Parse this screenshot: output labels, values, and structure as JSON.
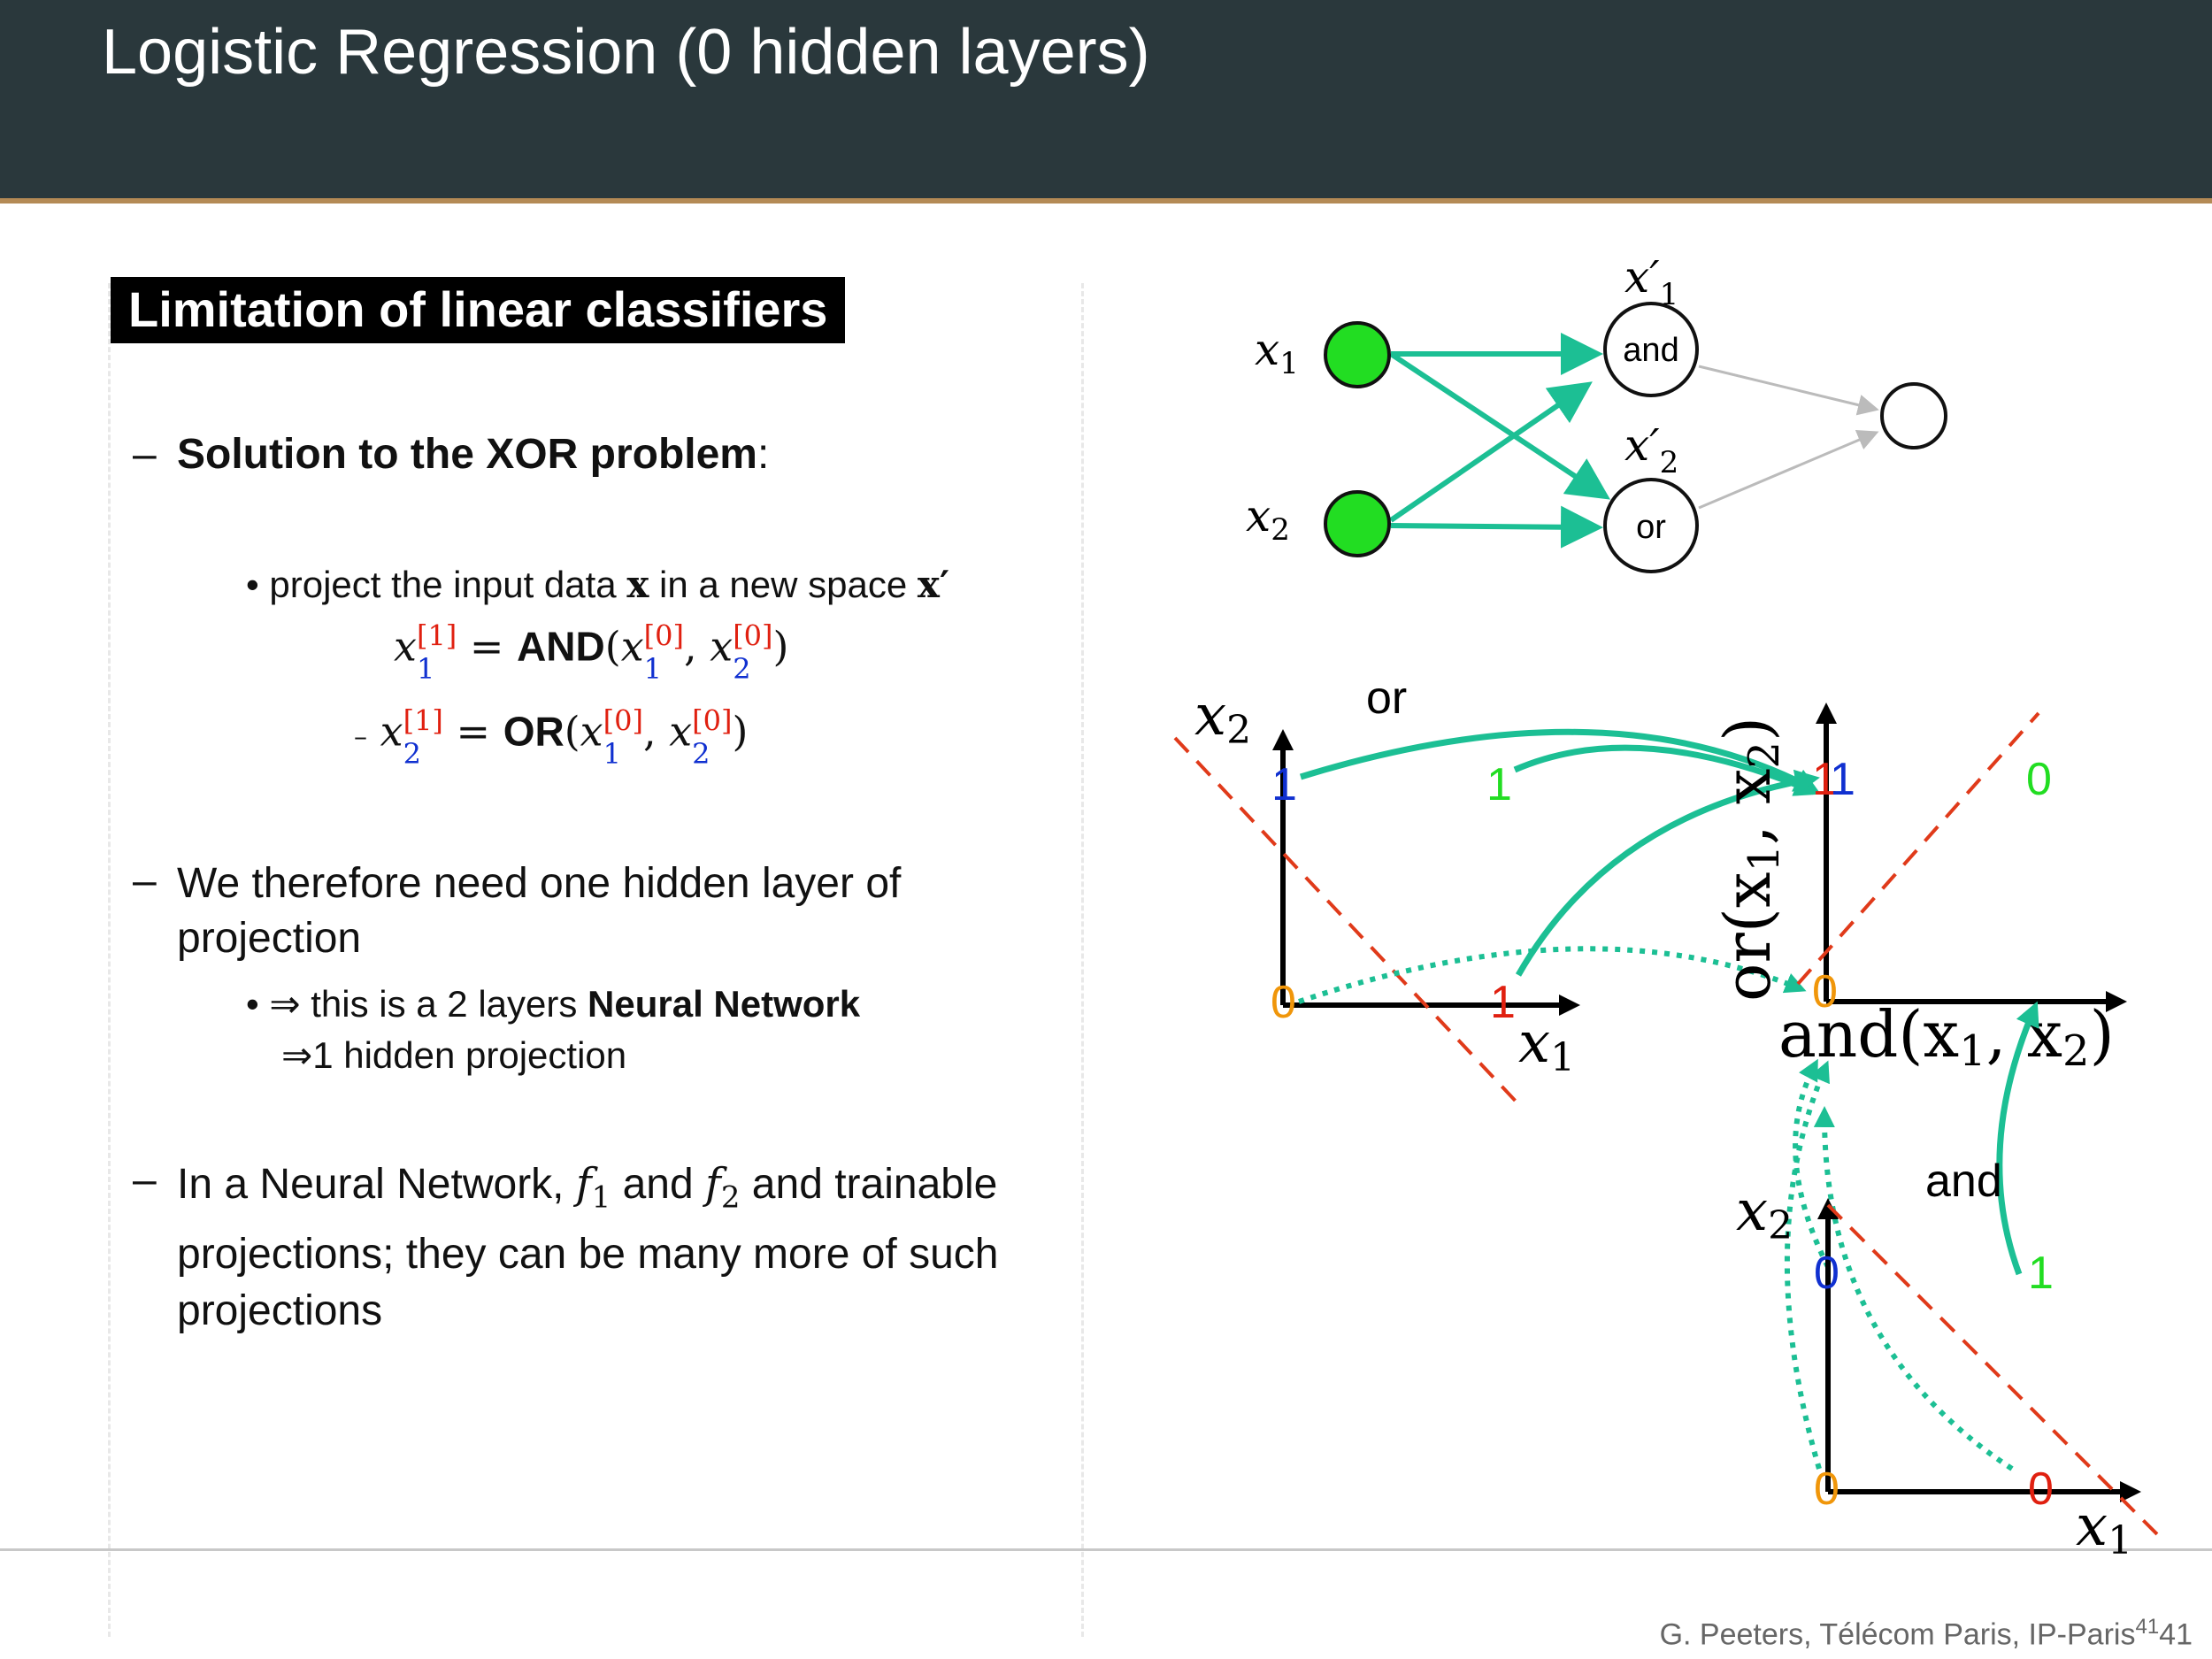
{
  "slide": {
    "title": "Logistic Regression (0 hidden layers)",
    "section_title": "Limitation of linear classifiers"
  },
  "left": {
    "item1_bold": "Solution to the XOR problem",
    "item1_tail": ":",
    "sub1": "project the input data",
    "sub1_mid": "in a new space",
    "vec_x": "x",
    "vec_xp": "x′",
    "eq1_fn": "AND",
    "eq2_fn": "OR",
    "item2_line1": "We therefore need one hidden layer of",
    "item2_line2": "projection",
    "sub2_pre": "⇒ this is a 2 layers",
    "sub2_bold": "Neural Network",
    "sub2_line2": "⇒1 hidden projection",
    "item3_pre": "In a Neural Network,",
    "item3_and": "and",
    "item3_post": "and trainable",
    "item3_line2": "projections; they can be many more of such",
    "item3_line3": "projections",
    "f1": "f",
    "f2": "f",
    "sub_1": "1",
    "sub_2": "2",
    "sup_1": "[1]",
    "sup_0": "[0]",
    "var_x": "x",
    "eq_sign": "=",
    "paren_open": "(",
    "paren_close": ")",
    "comma": ","
  },
  "network": {
    "input1": "x",
    "input2": "x",
    "hidden1_label": "x′",
    "hidden2_label": "x′",
    "hidden1_text": "and",
    "hidden2_text": "or",
    "sub1": "1",
    "sub2": "2"
  },
  "plots": {
    "left_ylabel": "x",
    "left_ylabel_sub": "2",
    "left_xlabel": "x",
    "left_xlabel_sub": "1",
    "or_label": "or",
    "and_label": "and",
    "right_ylabel": "or(x",
    "right_ylabel_mid": ", x",
    "right_ylabel_end": ")",
    "right_xlabel": "and(x",
    "right_xlabel_mid": ", x",
    "right_xlabel_end": ")",
    "bottom_ylabel": "x",
    "bottom_xlabel": "x",
    "v_0": "0",
    "v_1": "1",
    "colors": {
      "teal": "#1cbf94",
      "green": "#22dd22",
      "orange": "#f0960a",
      "blue": "#1030d0",
      "red": "#e02010",
      "dashed_line": "#e03a1a"
    }
  },
  "footer": {
    "text": "G. Peeters, Télécom Paris, IP-Paris",
    "page_small": "41",
    "page": "41"
  }
}
